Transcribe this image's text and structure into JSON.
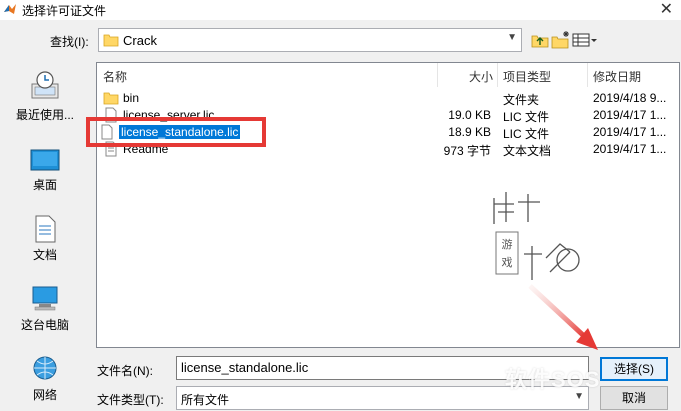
{
  "window": {
    "title": "选择许可证文件",
    "close_glyph": "✕"
  },
  "toolbar": {
    "lookin_label": "查找(I):",
    "lookin_value": "Crack"
  },
  "places": [
    {
      "label": "最近使用...",
      "icon": "recent-icon"
    },
    {
      "label": "桌面",
      "icon": "desktop-icon"
    },
    {
      "label": "文档",
      "icon": "documents-icon"
    },
    {
      "label": "这台电脑",
      "icon": "computer-icon"
    },
    {
      "label": "网络",
      "icon": "network-icon"
    }
  ],
  "columns": {
    "name": "名称",
    "size": "大小",
    "type": "项目类型",
    "date": "修改日期"
  },
  "files": [
    {
      "name": "bin",
      "size": "",
      "type": "文件夹",
      "date": "2019/4/18 9...",
      "icon": "folder-icon"
    },
    {
      "name": "license_server.lic",
      "size": "19.0 KB",
      "type": "LIC 文件",
      "date": "2019/4/17 1...",
      "icon": "file-icon"
    },
    {
      "name": "license_standalone.lic",
      "size": "18.9 KB",
      "type": "LIC 文件",
      "date": "2019/4/17 1...",
      "icon": "file-icon"
    },
    {
      "name": "Readme",
      "size": "973 字节",
      "type": "文本文档",
      "date": "2019/4/17 1...",
      "icon": "text-file-icon"
    }
  ],
  "watermark": {
    "vertical_text": "游戏"
  },
  "footer": {
    "filename_label": "文件名(N):",
    "filename_value": "license_standalone.lic",
    "filetype_label": "文件类型(T):",
    "filetype_value": "所有文件",
    "select_label": "选择(S)",
    "cancel_label": "取消",
    "site_mark": "软件SOS"
  },
  "colors": {
    "selection": "#0078d7",
    "highlight": "#e53935"
  }
}
